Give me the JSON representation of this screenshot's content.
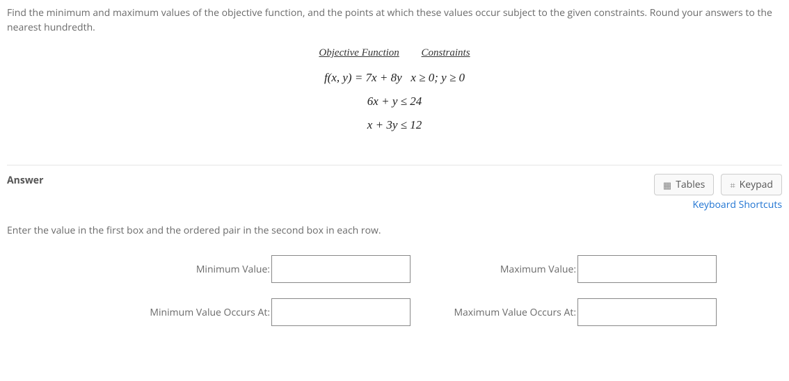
{
  "question": {
    "prompt": "Find the minimum and maximum values of the objective function, and the points at which these values occur subject to the given constraints. Round your answers to the nearest hundredth.",
    "headers": {
      "obj": "Objective Function",
      "con": "Constraints"
    },
    "lines": {
      "l1": "f(x, y) = 7x + 8y   x ≥ 0; y ≥ 0",
      "l2": "6x + y ≤ 24",
      "l3": "x + 3y ≤ 12"
    }
  },
  "answer": {
    "heading": "Answer",
    "tables_btn": "Tables",
    "keypad_btn": "Keypad",
    "shortcuts": "Keyboard Shortcuts",
    "instruction": "Enter the value in the first box and the ordered pair in the second box in each row.",
    "labels": {
      "min_val": "Minimum Value:",
      "max_val": "Maximum Value:",
      "min_at": "Minimum Value Occurs At:",
      "max_at": "Maximum Value Occurs At:"
    },
    "values": {
      "min_val": "",
      "max_val": "",
      "min_at": "",
      "max_at": ""
    }
  }
}
